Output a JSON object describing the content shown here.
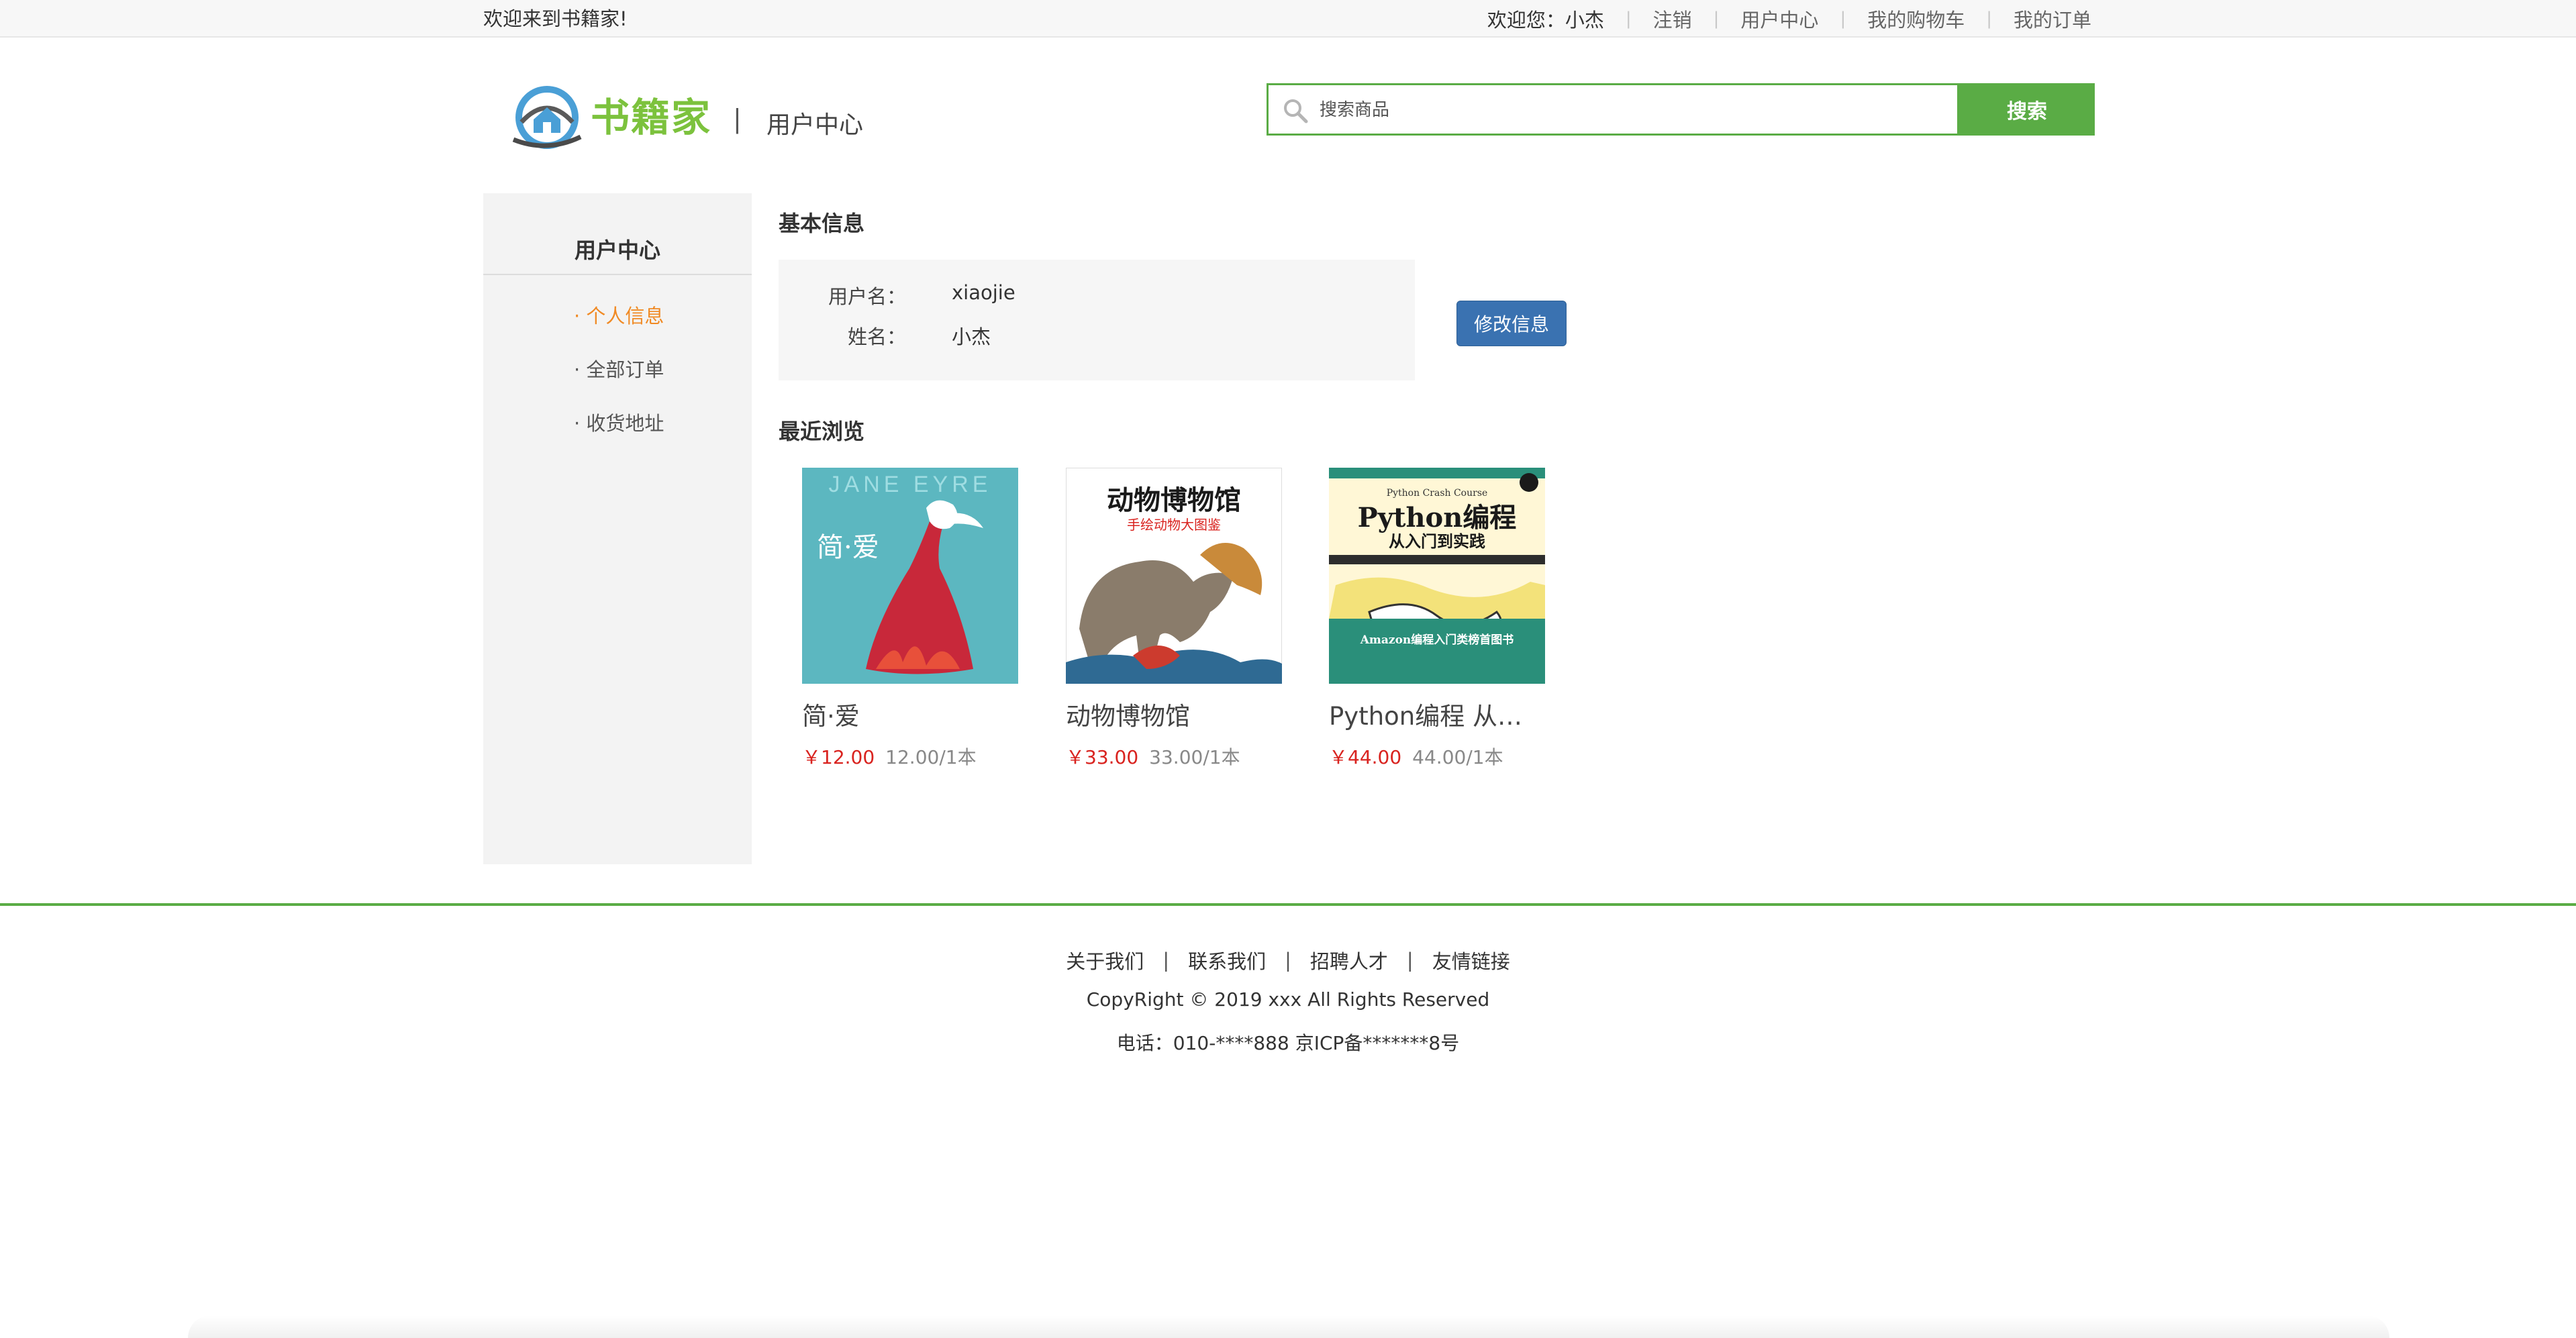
{
  "topbar": {
    "welcome": "欢迎来到书籍家!",
    "greeting_prefix": "欢迎您：",
    "username": "小杰",
    "links": [
      "注销",
      "用户中心",
      "我的购物车",
      "我的订单"
    ],
    "separator": "|"
  },
  "header": {
    "logo_text": "书籍家",
    "divider": "|",
    "title": "用户中心",
    "search_placeholder": "搜索商品",
    "search_button": "搜索",
    "accent_color": "#5aac45"
  },
  "sidebar": {
    "title": "用户中心",
    "items": [
      {
        "label": "· 个人信息",
        "active": true
      },
      {
        "label": "· 全部订单",
        "active": false
      },
      {
        "label": "· 收货地址",
        "active": false
      }
    ]
  },
  "profile": {
    "section_title": "基本信息",
    "fields": [
      {
        "label": "用户名：",
        "value": "xiaojie"
      },
      {
        "label": "姓名：",
        "value": "小杰"
      }
    ],
    "edit_button": "修改信息"
  },
  "recent": {
    "section_title": "最近浏览",
    "books": [
      {
        "name": "简·爱",
        "price": "￥12.00",
        "unit_price": "12.00/1本",
        "cover": "jane-eyre-cover",
        "cover_text": "JANE EYRE",
        "cover_title": "简·爱"
      },
      {
        "name": "动物博物馆",
        "price": "￥33.00",
        "unit_price": "33.00/1本",
        "cover": "animal-museum-cover",
        "cover_text": "动物博物馆",
        "cover_sub": "手绘动物大图鉴"
      },
      {
        "name": "Python编程 从入...",
        "price": "￥44.00",
        "unit_price": "44.00/1本",
        "cover": "python-crash-course-cover",
        "cover_text": "Python编程",
        "cover_sub": "从入门到实践",
        "cover_top": "Python Crash Course",
        "cover_band": "Amazon编程入门类榜首图书"
      }
    ]
  },
  "footer": {
    "links": [
      "关于我们",
      "联系我们",
      "招聘人才",
      "友情链接"
    ],
    "separator": "|",
    "copyright": "CopyRight © 2019 xxx All Rights Reserved",
    "contact": "电话：010-****888 京ICP备*******8号",
    "line_color": "#5aac45"
  }
}
